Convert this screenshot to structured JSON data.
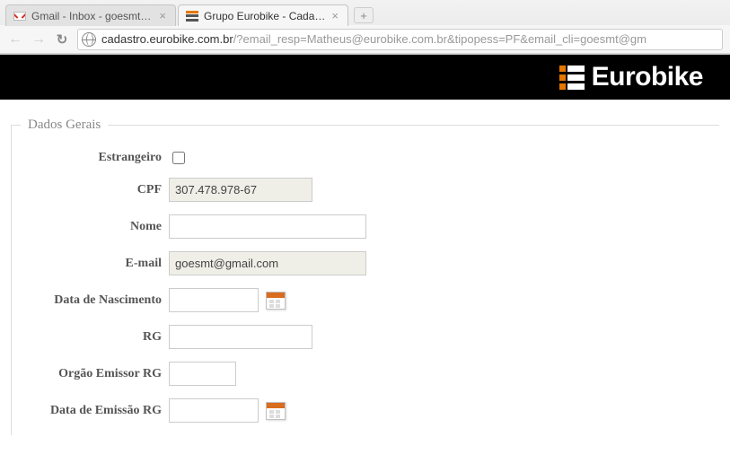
{
  "browser": {
    "tabs": [
      {
        "title": "Gmail - Inbox - goesmt@..."
      },
      {
        "title": "Grupo Eurobike - Cadastr..."
      }
    ],
    "url_host": "cadastro.eurobike.com.br",
    "url_rest": "/?email_resp=Matheus@eurobike.com.br&tipopess=PF&email_cli=goesmt@gm"
  },
  "header": {
    "logo_text": "Eurobike"
  },
  "form": {
    "legend": "Dados Gerais",
    "labels": {
      "estrangeiro": "Estrangeiro",
      "cpf": "CPF",
      "nome": "Nome",
      "email": "E-mail",
      "nascimento": "Data de Nascimento",
      "rg": "RG",
      "orgao_rg": "Orgão Emissor RG",
      "emissao_rg": "Data de Emissão RG"
    },
    "values": {
      "cpf": "307.478.978-67",
      "nome": "",
      "email": "goesmt@gmail.com",
      "nascimento": "",
      "rg": "",
      "orgao_rg": "",
      "emissao_rg": ""
    }
  }
}
